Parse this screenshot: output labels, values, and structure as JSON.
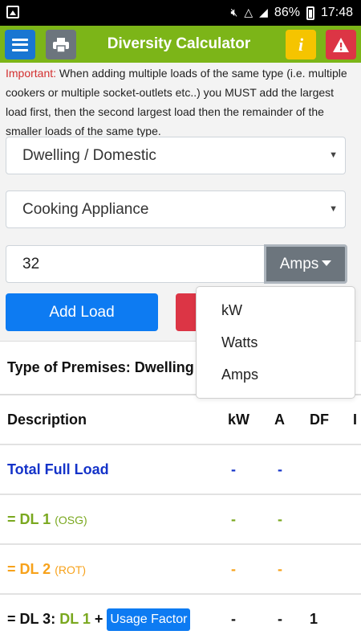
{
  "status": {
    "battery": "86%",
    "time": "17:48"
  },
  "appbar": {
    "title": "Diversity Calculator"
  },
  "notice": {
    "important": "Important:",
    "text": " When adding multiple loads of the same type (i.e. multiple cookers or multiple socket-outlets etc..) you MUST add the largest load first, then the second largest load then the remainder of the smaller loads of the same type."
  },
  "premises_select": {
    "value": "Dwelling / Domestic"
  },
  "appliance_select": {
    "value": "Cooking Appliance"
  },
  "load_input": {
    "value": "32"
  },
  "unit_button": {
    "label": "Amps"
  },
  "add_button": {
    "label": "Add Load"
  },
  "premises_type": "Type of Premises: Dwelling",
  "table": {
    "headers": {
      "description": "Description",
      "kw": "kW",
      "a": "A",
      "df": "DF",
      "extra": "I"
    },
    "rows": [
      {
        "label": "Total Full Load",
        "kw": "-",
        "a": "-"
      },
      {
        "label": "= DL 1",
        "note": "(OSG)",
        "kw": "-",
        "a": "-"
      },
      {
        "label": "= DL 2",
        "note": "(ROT)",
        "kw": "-",
        "a": "-"
      },
      {
        "prefix": "= DL 3: ",
        "dl": "DL 1",
        "plus": " + ",
        "badge": "Usage Factor",
        "kw": "-",
        "a": "-",
        "df": "1"
      }
    ]
  },
  "unit_dropdown": {
    "options": [
      "kW",
      "Watts",
      "Amps"
    ]
  },
  "colors": {
    "appbar": "#7cb518",
    "primary": "#0d7bf2",
    "danger": "#dc3545",
    "warning": "#f5c400",
    "secondary": "#6c757d"
  }
}
